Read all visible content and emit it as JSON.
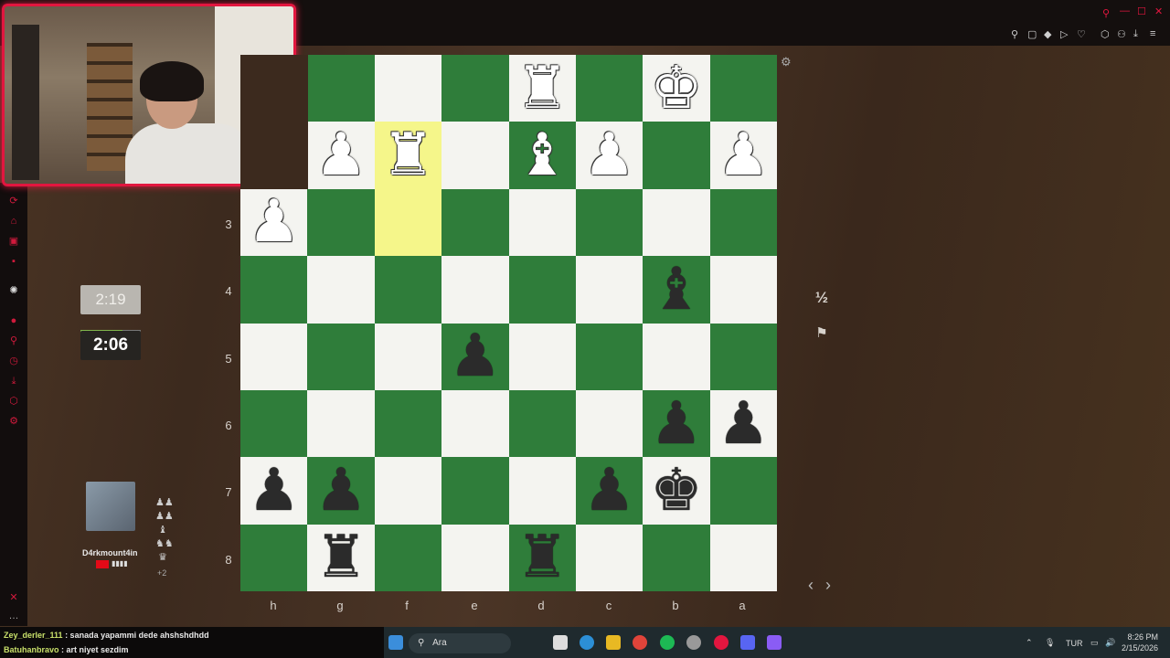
{
  "colors": {
    "light_square": "#f4f4f0",
    "dark_square": "#2f7d3a",
    "highlight": "#f5f68a",
    "accent": "#e2163f"
  },
  "board": {
    "rows": [
      [
        "",
        "",
        "",
        "",
        "wR",
        "",
        "wK",
        ""
      ],
      [
        "",
        "wP",
        "wR",
        "",
        "wB",
        "wP",
        "",
        "wP"
      ],
      [
        "wP",
        "",
        "",
        "",
        "",
        "",
        "",
        ""
      ],
      [
        "",
        "",
        "",
        "",
        "",
        "",
        "bB",
        ""
      ],
      [
        "",
        "",
        "",
        "bP",
        "",
        "",
        "",
        ""
      ],
      [
        "",
        "",
        "",
        "",
        "",
        "",
        "bP",
        "bP"
      ],
      [
        "bP",
        "bP",
        "",
        "",
        "",
        "bP",
        "bK",
        ""
      ],
      [
        "",
        "bR",
        "",
        "",
        "bR",
        "",
        "",
        ""
      ]
    ],
    "highlights": [
      [
        1,
        2
      ],
      [
        2,
        2
      ]
    ],
    "ranks": [
      "3",
      "4",
      "5",
      "6",
      "7",
      "8"
    ],
    "files": [
      "h",
      "g",
      "f",
      "e",
      "d",
      "c",
      "b",
      "a"
    ]
  },
  "clocks": {
    "opponent": "2:19",
    "player": "2:06"
  },
  "player": {
    "name": "D4rkmount4in",
    "rating": "▮▮▮▮",
    "captured_more": "+2"
  },
  "side": {
    "draw_label": "½",
    "resign_icon": "flag-icon",
    "prev": "‹",
    "next": "›"
  },
  "chat": [
    {
      "user": "Zey_derler_111",
      "msg": " : sanada yapammi dede ahshshdhdd"
    },
    {
      "user": "Batuhanbravo",
      "msg": " : art niyet sezdim"
    }
  ],
  "taskbar": {
    "search_placeholder": "Ara",
    "lang": "TUR",
    "time": "8:26 PM",
    "date": "2/15/2026"
  }
}
